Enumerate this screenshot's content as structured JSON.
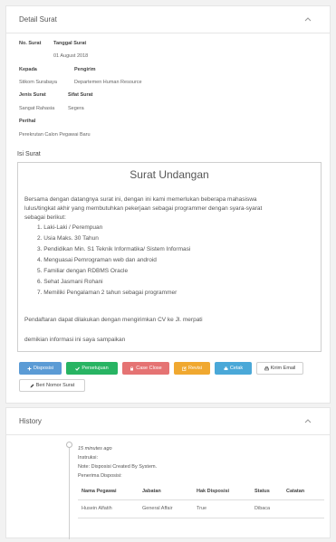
{
  "detail": {
    "title": "Detail Surat",
    "no_surat_label": "No. Surat",
    "tanggal_label": "Tanggal Surat",
    "tanggal_value": "01 August 2018",
    "kepada_label": "Kepada",
    "kepada_value": "Stikom Surabaya",
    "pengirim_label": "Pengirim",
    "pengirim_value": "Departemen Human Resource",
    "jenis_label": "Jenis Surat",
    "jenis_value": "Sangat Rahasia",
    "sifat_label": "Sifat Surat",
    "sifat_value": "Segera",
    "perihal_label": "Perihal",
    "perihal_value": "Perekrutan Calon Pegawai Baru",
    "isi_label": "Isi Surat"
  },
  "letter": {
    "title": "Surat Undangan",
    "intro1": "Bersama dengan datangnya surat ini, dengan ini kami memerlukan beberapa mahasiswa",
    "intro2": "lulus/tingkat akhir yang membutuhkan pekerjaan sebagai programmer dengan syara-syarat",
    "intro3": "sebagai berikut:",
    "requirements": [
      "1. Laki-Laki / Perempuan",
      "2. Usia Maks. 30 Tahun",
      "3. Pendidikan Min. S1 Teknik Informatika/ Sistem Informasi",
      "4. Menguasai Pemrograman web dan android",
      "5. Familiar dengan RDBMS Oracle",
      "6. Sehat Jasmani Rohani",
      "7. Memiliki Pengalaman 2 tahun sebagai programmer"
    ],
    "closing1": "Pendaftaran dapat dilakukan dengan mengirimkan CV ke Jl. merpati",
    "closing2": "demikian informasi ini saya sampaikan"
  },
  "buttons": {
    "disposisi": "Disposisi",
    "persetujuan": "Persetujuan",
    "case_close": "Case Close",
    "revisi": "Revisi",
    "cetak": "Cetak",
    "kirim_email": "Kirim Email",
    "beri_nomor": "Beri Nomor Surat"
  },
  "colors": {
    "disposisi": "#5b9bd5",
    "persetujuan": "#28b463",
    "case_close": "#e57373",
    "revisi": "#f0a830",
    "cetak": "#4aa8d8"
  },
  "history": {
    "title": "History",
    "time": "15 minutes ago",
    "instruksi": "Instruksi:",
    "note": "Note: Disposisi Created By System.",
    "penerima": "Penerima Disposisi:",
    "headers": [
      "Nama Pegawai",
      "Jabatan",
      "Hak Disposisi",
      "Status",
      "Catatan"
    ],
    "row": [
      "Husein Alfatih",
      "General Affair",
      "True",
      "Dibaca",
      ""
    ]
  },
  "icons": {
    "collapse": "chevron-up-icon",
    "disposisi": "plus-icon",
    "persetujuan": "check-icon",
    "case_close": "lock-icon",
    "revisi": "edit-icon",
    "cetak": "print-icon",
    "kirim_email": "printer-icon",
    "beri_nomor": "pencil-icon"
  }
}
